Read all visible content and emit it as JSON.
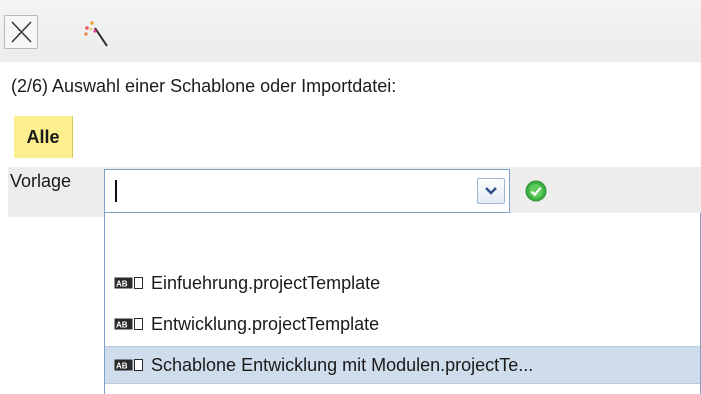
{
  "toolbar": {
    "buttons": [
      {
        "icon": "close-icon"
      },
      {
        "icon": "magic-wand-icon"
      }
    ]
  },
  "wizard": {
    "step_text": "(2/6) Auswahl einer Schablone oder Importdatei:"
  },
  "tabs": [
    {
      "label": "Alle",
      "active": true
    }
  ],
  "form": {
    "field_label": "Vorlage",
    "field_value": "",
    "confirm_icon": "check-circle-icon"
  },
  "dropdown": {
    "items": [
      {
        "label": "",
        "icon": ""
      },
      {
        "label": "Einfuehrung.projectTemplate",
        "icon": "text-field-icon"
      },
      {
        "label": "Entwicklung.projectTemplate",
        "icon": "text-field-icon"
      },
      {
        "label": "Schablone Entwicklung mit Modulen.projectTe...",
        "icon": "text-field-icon",
        "highlighted": true
      }
    ]
  },
  "colors": {
    "tab_active": "#fbef8e",
    "highlight": "#cfdcec",
    "confirm": "#3cb043",
    "field_border": "#7fa1c9"
  }
}
